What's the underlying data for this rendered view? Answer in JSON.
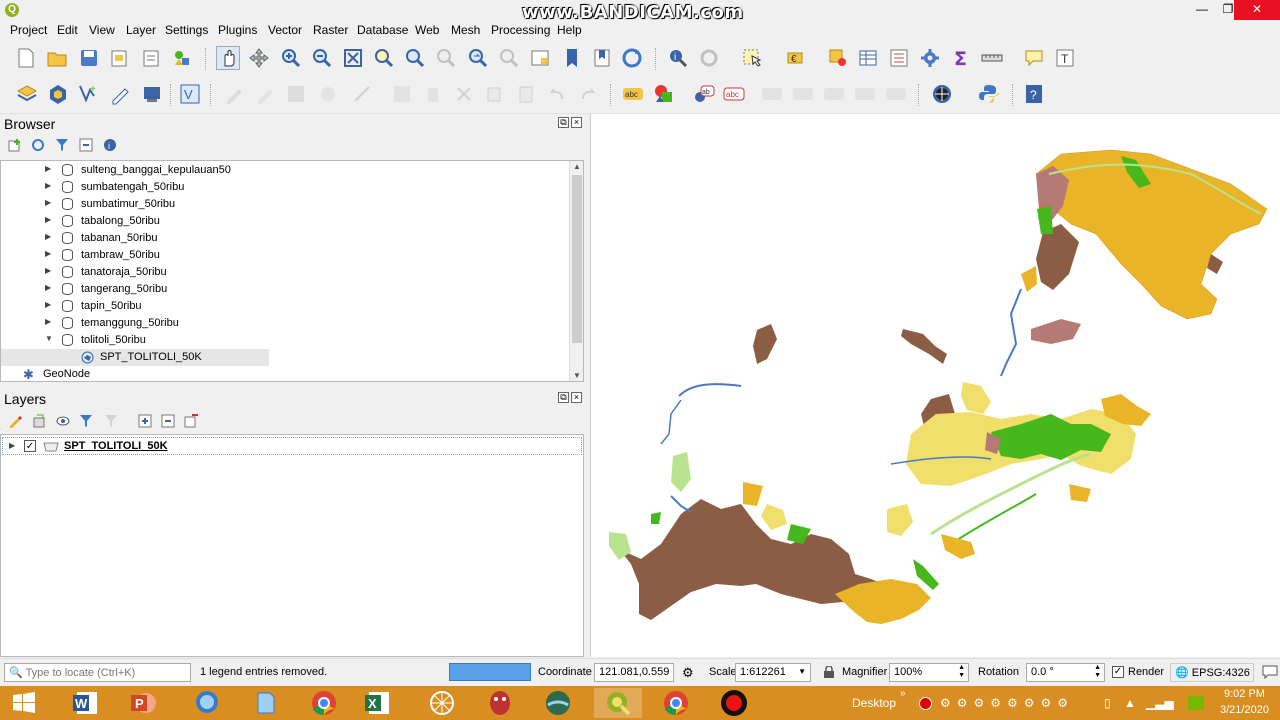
{
  "window": {
    "watermark": "www.BANDICAM.com",
    "logo": "Q",
    "minimize": "—",
    "maximize": "❐",
    "close": "✕"
  },
  "menu": [
    "Project",
    "Edit",
    "View",
    "Layer",
    "Settings",
    "Plugins",
    "Vector",
    "Raster",
    "Database",
    "Web",
    "Mesh",
    "Processing",
    "Help"
  ],
  "browser": {
    "title": "Browser",
    "items": [
      {
        "label": "sulteng_banggai_kepulauan50",
        "expanded": false
      },
      {
        "label": "sumbatengah_50ribu",
        "expanded": false
      },
      {
        "label": "sumbatimur_50ribu",
        "expanded": false
      },
      {
        "label": "tabalong_50ribu",
        "expanded": false
      },
      {
        "label": "tabanan_50ribu",
        "expanded": false
      },
      {
        "label": "tambraw_50ribu",
        "expanded": false
      },
      {
        "label": "tanatoraja_50ribu",
        "expanded": false
      },
      {
        "label": "tangerang_50ribu",
        "expanded": false
      },
      {
        "label": "tapin_50ribu",
        "expanded": false
      },
      {
        "label": "temanggung_50ribu",
        "expanded": false
      },
      {
        "label": "tolitoli_50ribu",
        "expanded": true
      }
    ],
    "child": "SPT_TOLITOLI_50K",
    "geonode": "GeoNode"
  },
  "layers": {
    "title": "Layers",
    "items": [
      {
        "label": "SPT_TOLITOLI_50K",
        "checked": true
      }
    ]
  },
  "status": {
    "locate_placeholder": "Type to locate (Ctrl+K)",
    "message": "1 legend entries removed.",
    "coordinate_label": "Coordinate",
    "coordinate_value": "121.081,0.559",
    "scale_label": "Scale",
    "scale_value": "1:612261",
    "magnifier_label": "Magnifier",
    "magnifier_value": "100%",
    "rotation_label": "Rotation",
    "rotation_value": "0.0 °",
    "render_label": "Render",
    "render_checked": true,
    "crs": "EPSG:4326"
  },
  "taskbar": {
    "desktop_label": "Desktop",
    "time": "9:02 PM",
    "date": "3/21/2020",
    "apps": [
      "windows-start",
      "word",
      "powerpoint",
      "search",
      "notepad",
      "chrome",
      "excel",
      "network",
      "mascot",
      "globe",
      "qgis",
      "chrome",
      "record"
    ],
    "active_app": "qgis"
  },
  "colors": {
    "brown": "#8b5d45",
    "gold": "#e9b427",
    "lightyellow": "#f0df6b",
    "green": "#47b81c",
    "lightgreen": "#b9e38e",
    "water": "#4a79c8",
    "pink": "#b57a74",
    "taskbar": "#d88e21"
  }
}
